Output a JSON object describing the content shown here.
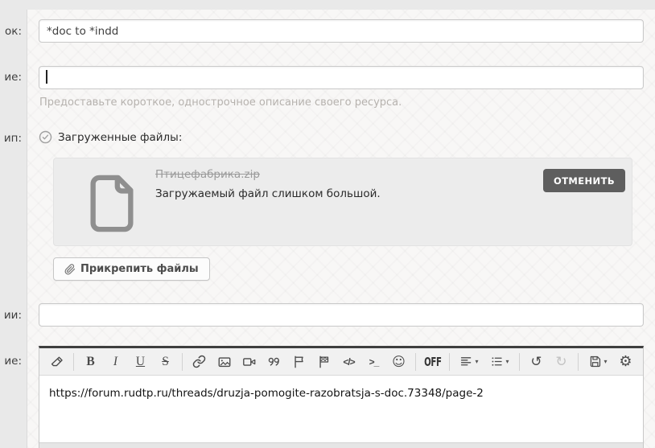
{
  "colors": {
    "page_bg": "#e9e9e9",
    "content_bg": "#f8f7f6",
    "input_border": "#c9c9c9",
    "hint_text": "#b6b2ae",
    "file_panel_bg": "#ececec",
    "filename_muted": "#9b9b9b",
    "error_text": "#2b2b2b",
    "cancel_button_bg": "#5e5e5e",
    "cancel_button_text": "#ffffff",
    "editor_top_border": "#3f3f3f",
    "toolbar_bg": "#f1f1f1",
    "toolbar_icon": "#4a4a4a"
  },
  "form": {
    "title": {
      "label": "ок:",
      "value": "*doc to *indd"
    },
    "tagline": {
      "label": "ие:",
      "value": "",
      "hint": "Предоставьте короткое, однострочное описание своего ресурса."
    },
    "type": {
      "label": "ип:",
      "selected_option": "Загруженные файлы:"
    },
    "upload": {
      "filename": "Птицефабрика.zip",
      "error": "Загружаемый файл слишком большой.",
      "cancel_label": "ОТМЕНИТЬ",
      "attach_label": "Прикрепить файлы"
    },
    "version": {
      "label": "ии:",
      "value": ""
    },
    "message": {
      "label": "ие:"
    }
  },
  "editor": {
    "toolbar": {
      "bold": "B",
      "italic": "I",
      "underline": "U",
      "strike": "S",
      "code": "</>",
      "inline_code": ">_",
      "bbcode_toggle": "OFF"
    },
    "icons": [
      "eraser-icon",
      "link-icon",
      "image-icon",
      "video-camera-icon",
      "quote-icon",
      "flag-icon",
      "checkered-flag-icon",
      "smiley-icon",
      "align-left-icon",
      "list-icon",
      "undo-icon",
      "redo-icon",
      "floppy-save-icon",
      "gear-icon",
      "check-circle-icon",
      "file-icon",
      "paperclip-icon"
    ],
    "content": "https://forum.rudtp.ru/threads/druzja-pomogite-razobratsja-s-doc.73348/page-2"
  }
}
